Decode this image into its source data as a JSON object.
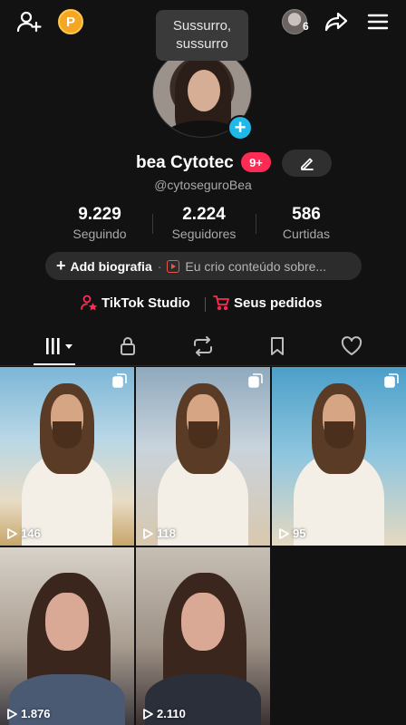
{
  "tooltip": {
    "line1": "Sussurro,",
    "line2": "sussurro"
  },
  "topbar": {
    "add_friend_icon": "person-plus-icon",
    "coin_label": "P",
    "friend_count": "6",
    "share_icon": "share-arrow-icon",
    "menu_icon": "hamburger-menu-icon"
  },
  "profile": {
    "name": "bea Cytotec",
    "notification_badge": "9+",
    "handle": "@cytoseguroBea"
  },
  "stats": [
    {
      "value": "9.229",
      "label": "Seguindo"
    },
    {
      "value": "2.224",
      "label": "Seguidores"
    },
    {
      "value": "586",
      "label": "Curtidas"
    }
  ],
  "bio": {
    "add_label": "Add biografia",
    "separator": "·",
    "suggestion": "Eu crio conteúdo sobre..."
  },
  "links": {
    "studio": "TikTok Studio",
    "orders": "Seus pedidos"
  },
  "tabs": [
    {
      "icon": "videos-grid-icon",
      "active": true
    },
    {
      "icon": "lock-icon",
      "active": false
    },
    {
      "icon": "repost-icon",
      "active": false
    },
    {
      "icon": "bookmark-icon",
      "active": false
    },
    {
      "icon": "heart-icon",
      "active": false
    }
  ],
  "videos": [
    {
      "views": "146",
      "multi": true
    },
    {
      "views": "118",
      "multi": true
    },
    {
      "views": "95",
      "multi": true
    },
    {
      "views": "1.876",
      "multi": false
    },
    {
      "views": "2.110",
      "multi": false
    }
  ],
  "colors": {
    "accent_red": "#fe2c55",
    "accent_blue": "#20b8e8",
    "background": "#121212"
  }
}
